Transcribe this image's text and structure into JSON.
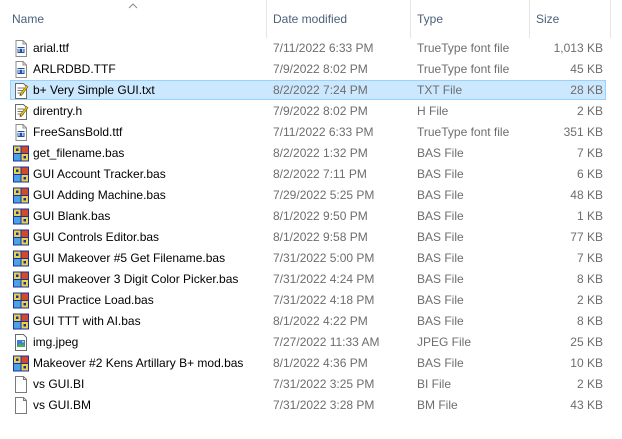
{
  "columns": {
    "name": "Name",
    "date": "Date modified",
    "type": "Type",
    "size": "Size"
  },
  "files": [
    {
      "name": "arial.ttf",
      "date": "7/11/2022 6:33 PM",
      "type": "TrueType font file",
      "size": "1,013 KB",
      "icon": "font-file-icon",
      "selected": false
    },
    {
      "name": "ARLRDBD.TTF",
      "date": "7/9/2022 8:02 PM",
      "type": "TrueType font file",
      "size": "45 KB",
      "icon": "font-file-icon",
      "selected": false
    },
    {
      "name": "b+ Very Simple GUI.txt",
      "date": "8/2/2022 7:24 PM",
      "type": "TXT File",
      "size": "28 KB",
      "icon": "text-file-icon",
      "selected": true
    },
    {
      "name": "direntry.h",
      "date": "7/9/2022 8:02 PM",
      "type": "H File",
      "size": "2 KB",
      "icon": "text-file-icon",
      "selected": false
    },
    {
      "name": "FreeSansBold.ttf",
      "date": "7/11/2022 6:33 PM",
      "type": "TrueType font file",
      "size": "351 KB",
      "icon": "font-file-icon",
      "selected": false
    },
    {
      "name": "get_filename.bas",
      "date": "8/2/2022 1:32 PM",
      "type": "BAS File",
      "size": "7 KB",
      "icon": "qb64-file-icon",
      "selected": false
    },
    {
      "name": "GUI Account Tracker.bas",
      "date": "8/2/2022 7:11 PM",
      "type": "BAS File",
      "size": "6 KB",
      "icon": "qb64-file-icon",
      "selected": false
    },
    {
      "name": "GUI Adding Machine.bas",
      "date": "7/29/2022 5:25 PM",
      "type": "BAS File",
      "size": "48 KB",
      "icon": "qb64-file-icon",
      "selected": false
    },
    {
      "name": "GUI Blank.bas",
      "date": "8/1/2022 9:50 PM",
      "type": "BAS File",
      "size": "1 KB",
      "icon": "qb64-file-icon",
      "selected": false
    },
    {
      "name": "GUI Controls Editor.bas",
      "date": "8/1/2022 9:58 PM",
      "type": "BAS File",
      "size": "77 KB",
      "icon": "qb64-file-icon",
      "selected": false
    },
    {
      "name": "GUI Makeover #5 Get Filename.bas",
      "date": "7/31/2022 5:00 PM",
      "type": "BAS File",
      "size": "7 KB",
      "icon": "qb64-file-icon",
      "selected": false
    },
    {
      "name": "GUI makeover 3 Digit Color Picker.bas",
      "date": "7/31/2022 4:24 PM",
      "type": "BAS File",
      "size": "8 KB",
      "icon": "qb64-file-icon",
      "selected": false
    },
    {
      "name": "GUI Practice Load.bas",
      "date": "7/31/2022 4:18 PM",
      "type": "BAS File",
      "size": "2 KB",
      "icon": "qb64-file-icon",
      "selected": false
    },
    {
      "name": "GUI TTT with AI.bas",
      "date": "8/1/2022 4:22 PM",
      "type": "BAS File",
      "size": "8 KB",
      "icon": "qb64-file-icon",
      "selected": false
    },
    {
      "name": "img.jpeg",
      "date": "7/27/2022 11:33 AM",
      "type": "JPEG File",
      "size": "25 KB",
      "icon": "image-file-icon",
      "selected": false
    },
    {
      "name": "Makeover #2 Kens Artillary B+ mod.bas",
      "date": "8/1/2022 4:36 PM",
      "type": "BAS File",
      "size": "10 KB",
      "icon": "qb64-file-icon",
      "selected": false
    },
    {
      "name": "vs GUI.BI",
      "date": "7/31/2022 3:25 PM",
      "type": "BI File",
      "size": "2 KB",
      "icon": "blank-file-icon",
      "selected": false
    },
    {
      "name": "vs GUI.BM",
      "date": "7/31/2022 3:28 PM",
      "type": "BM File",
      "size": "43 KB",
      "icon": "blank-file-icon",
      "selected": false
    }
  ],
  "colors": {
    "header_text": "#4c607a",
    "secondary_text": "#6d6d6d",
    "selection_fill": "#cce8ff",
    "selection_border": "#99d1ff"
  }
}
